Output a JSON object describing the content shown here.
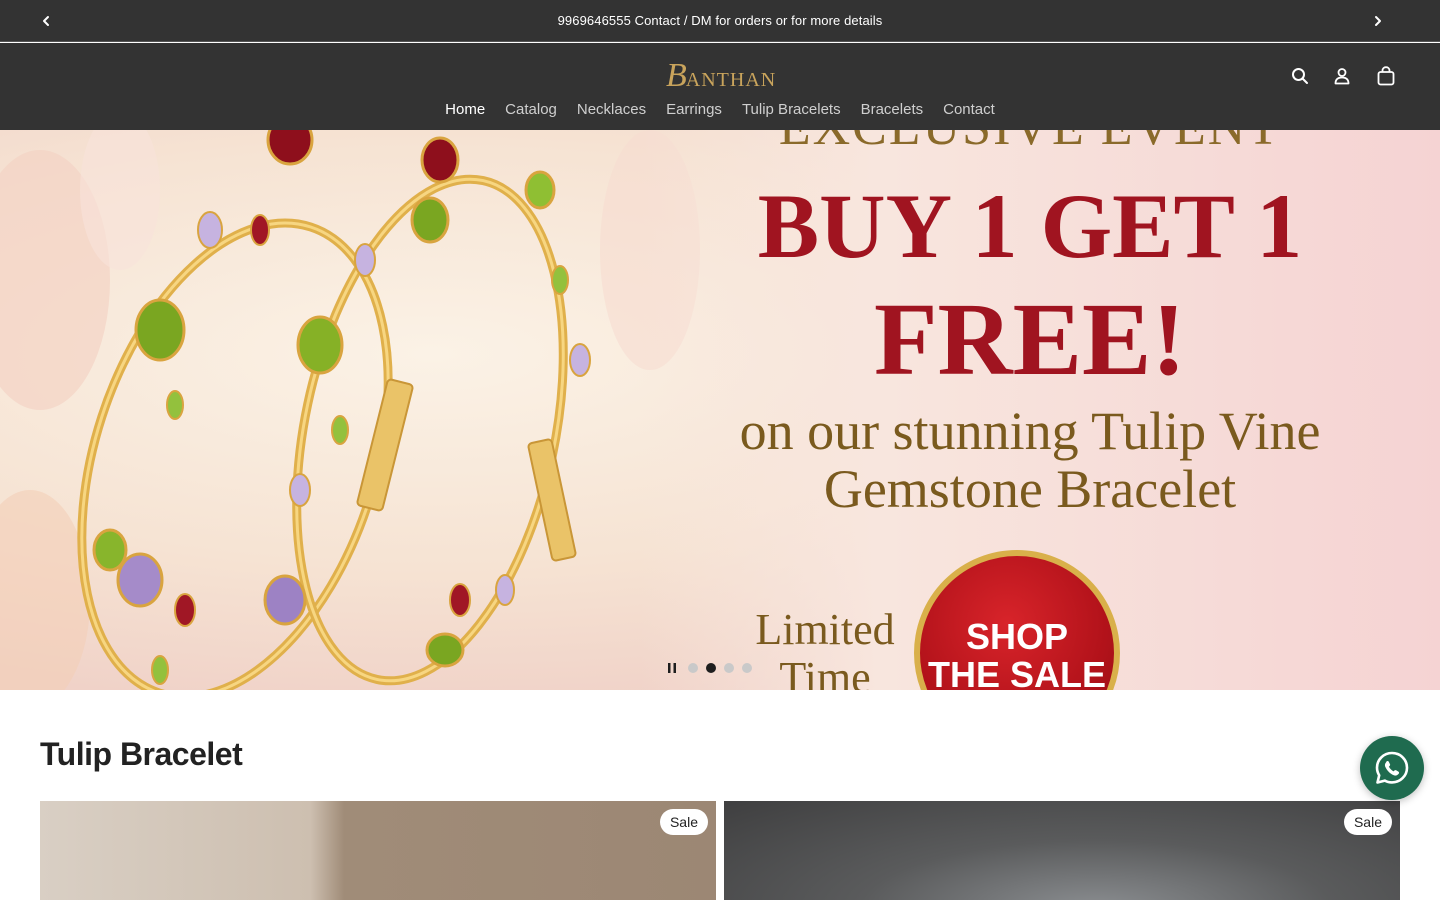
{
  "announcement": {
    "text": "9969646555 Contact / DM for orders or for more details",
    "prev_icon": "chevron-left-icon",
    "next_icon": "chevron-right-icon"
  },
  "header": {
    "logo_initial": "B",
    "logo_rest": "ANTHAN",
    "logo_color": "#c9a45c",
    "background": "#333333",
    "nav": [
      {
        "label": "Home",
        "active": true
      },
      {
        "label": "Catalog"
      },
      {
        "label": "Necklaces"
      },
      {
        "label": "Earrings"
      },
      {
        "label": "Tulip Bracelets"
      },
      {
        "label": "Bracelets"
      },
      {
        "label": "Contact"
      }
    ],
    "icons": [
      "search-icon",
      "account-icon",
      "cart-icon"
    ]
  },
  "hero": {
    "line0": "EXCLUSIVE EVENT",
    "line1": "BUY 1 GET 1",
    "line2": "FREE!",
    "sub1": "on our stunning Tulip Vine",
    "sub2": "Gemstone Bracelet",
    "limited1": "Limited",
    "limited2": "Time Offer!",
    "badge1": "SHOP",
    "badge2": "THE SALE",
    "slides": 4,
    "active_slide": 2
  },
  "section": {
    "title": "Tulip Bracelet",
    "cards": [
      {
        "badge": "Sale"
      },
      {
        "badge": "Sale"
      }
    ]
  },
  "whatsapp": {
    "icon": "whatsapp-icon",
    "color": "#1f6b4f"
  }
}
